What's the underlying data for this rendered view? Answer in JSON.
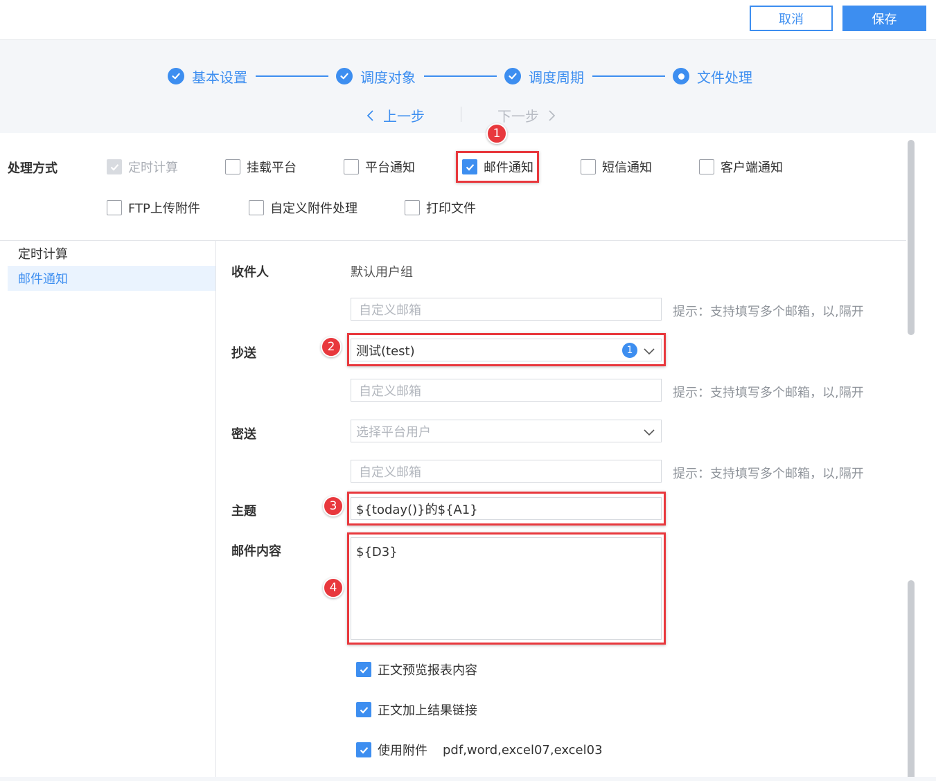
{
  "header": {
    "cancel_label": "取消",
    "save_label": "保存"
  },
  "steps": [
    {
      "label": "基本设置",
      "state": "done"
    },
    {
      "label": "调度对象",
      "state": "done"
    },
    {
      "label": "调度周期",
      "state": "done"
    },
    {
      "label": "文件处理",
      "state": "current"
    }
  ],
  "nav": {
    "prev_label": "上一步",
    "next_label": "下一步"
  },
  "methods": {
    "label": "处理方式",
    "options": [
      {
        "label": "定时计算",
        "checked": true,
        "disabled": true
      },
      {
        "label": "挂载平台",
        "checked": false
      },
      {
        "label": "平台通知",
        "checked": false
      },
      {
        "label": "邮件通知",
        "checked": true
      },
      {
        "label": "短信通知",
        "checked": false
      },
      {
        "label": "客户端通知",
        "checked": false
      },
      {
        "label": "FTP上传附件",
        "checked": false
      },
      {
        "label": "自定义附件处理",
        "checked": false
      },
      {
        "label": "打印文件",
        "checked": false
      }
    ]
  },
  "sidebar": {
    "items": [
      {
        "label": "定时计算",
        "active": false
      },
      {
        "label": "邮件通知",
        "active": true
      }
    ]
  },
  "form": {
    "recipient": {
      "label": "收件人",
      "value": "默认用户组",
      "custom_placeholder": "自定义邮箱"
    },
    "cc": {
      "label": "抄送",
      "value": "测试(test)",
      "count": "1",
      "custom_placeholder": "自定义邮箱"
    },
    "bcc": {
      "label": "密送",
      "placeholder": "选择平台用户",
      "custom_placeholder": "自定义邮箱"
    },
    "hint": "提示：支持填写多个邮箱，以,隔开",
    "subject": {
      "label": "主题",
      "value": "${today()}的${A1}"
    },
    "content": {
      "label": "邮件内容",
      "value": "${D3}"
    },
    "options": [
      {
        "label": "正文预览报表内容",
        "checked": true
      },
      {
        "label": "正文加上结果链接",
        "checked": true
      },
      {
        "label": "使用附件",
        "checked": true,
        "extra": "pdf,word,excel07,excel03"
      }
    ]
  },
  "annotations": [
    "1",
    "2",
    "3",
    "4"
  ],
  "colors": {
    "accent": "#3d8ef0",
    "annotation": "#e8383d"
  }
}
